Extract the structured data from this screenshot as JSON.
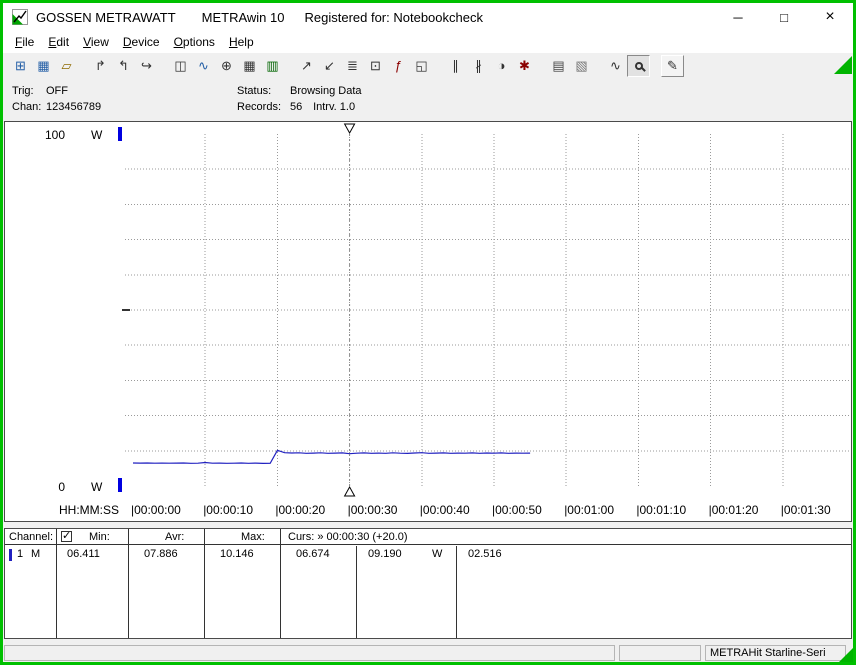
{
  "window": {
    "title_brand": "GOSSEN METRAWATT",
    "title_app": "METRAwin 10",
    "title_registered": "Registered for: Notebookcheck",
    "controls": {
      "minimize": "─",
      "maximize": "□",
      "close": "×"
    }
  },
  "menu": {
    "items": [
      "File",
      "Edit",
      "View",
      "Device",
      "Options",
      "Help"
    ]
  },
  "toolbar": {
    "groups": [
      [
        {
          "name": "export-file",
          "glyph": "⊞",
          "color": "#245fa6"
        },
        {
          "name": "save-file",
          "glyph": "▦",
          "color": "#245fa6"
        },
        {
          "name": "open-file",
          "glyph": "▱",
          "color": "#8f6a00"
        }
      ],
      [
        {
          "name": "export-data",
          "glyph": "↱",
          "color": "#333333"
        },
        {
          "name": "import-data",
          "glyph": "↰",
          "color": "#333333"
        },
        {
          "name": "transfer-data",
          "glyph": "↪",
          "color": "#333333"
        }
      ],
      [
        {
          "name": "multimeter-view",
          "glyph": "◫",
          "color": "#333333"
        },
        {
          "name": "trend-view",
          "glyph": "∿",
          "color": "#245fa6"
        },
        {
          "name": "scope-view",
          "glyph": "⊕",
          "color": "#333333"
        },
        {
          "name": "table-view",
          "glyph": "▦",
          "color": "#333333"
        },
        {
          "name": "bargraph-view",
          "glyph": "▥",
          "color": "#006400"
        }
      ],
      [
        {
          "name": "graph-export",
          "glyph": "↗",
          "color": "#333333"
        },
        {
          "name": "graph-import",
          "glyph": "↙",
          "color": "#333333"
        },
        {
          "name": "data-logger",
          "glyph": "≣",
          "color": "#333333"
        },
        {
          "name": "device-monitor",
          "glyph": "⊡",
          "color": "#333333"
        },
        {
          "name": "function-display",
          "glyph": "ƒ",
          "color": "#8b0000"
        },
        {
          "name": "live-display",
          "glyph": "◱",
          "color": "#333333"
        }
      ],
      [
        {
          "name": "cursor-left",
          "glyph": "∥",
          "color": "#333333"
        },
        {
          "name": "cursor-right",
          "glyph": "∦",
          "color": "#333333"
        },
        {
          "name": "time-range",
          "glyph": "◑",
          "color": "#333333"
        },
        {
          "name": "event-marker",
          "glyph": "✱",
          "color": "#8b0000"
        }
      ],
      [
        {
          "name": "print",
          "glyph": "▤",
          "color": "#444444"
        },
        {
          "name": "print-preview",
          "glyph": "▧",
          "color": "#777777"
        }
      ],
      [
        {
          "name": "zoom-signal",
          "glyph": "∿",
          "color": "#333333"
        },
        {
          "name": "zoom",
          "glyph": "@magnifier",
          "color": "#333333",
          "state": "pressed"
        }
      ],
      [
        {
          "name": "annotation",
          "glyph": "✎",
          "color": "#333333",
          "state": "raised"
        }
      ]
    ]
  },
  "infobar": {
    "trig_label": "Trig:",
    "trig_value": "OFF",
    "chan_label": "Chan:",
    "chan_value": "123456789",
    "status_label": "Status:",
    "status_value": "Browsing Data",
    "records_label": "Records:",
    "records_value": "56",
    "interval_label": "Intrv.",
    "interval_value": "1.0"
  },
  "chart_data": {
    "type": "line",
    "title": "",
    "ylabel": "W",
    "y_top_label": "100",
    "y_bottom_label": "0",
    "ylim": [
      0,
      100
    ],
    "y_grid_interval": 10,
    "grid": true,
    "x_axis_label": "HH:MM:SS",
    "x_tick_seconds": [
      0,
      10,
      20,
      30,
      40,
      50,
      60,
      70,
      80,
      90
    ],
    "x_tick_labels": [
      "00:00:00",
      "00:00:10",
      "00:00:20",
      "00:00:30",
      "00:00:40",
      "00:00:50",
      "00:01:00",
      "00:01:10",
      "00:01:20",
      "00:01:30"
    ],
    "x_visible_span_s": 101,
    "axis_marker_color": "#0000e0",
    "cursor": {
      "time_s": 30,
      "time_label": "00:00:30",
      "offset_label": "+20.0"
    },
    "series": [
      {
        "name": "Channel 1",
        "unit": "W",
        "color": "#2020c0",
        "start_s": 0,
        "interval_s": 1.0,
        "values": [
          6.53,
          6.5,
          6.52,
          6.48,
          6.51,
          6.47,
          6.5,
          6.53,
          6.46,
          6.49,
          6.67,
          6.47,
          6.5,
          6.45,
          6.48,
          6.52,
          6.46,
          6.5,
          6.41,
          6.45,
          10.15,
          9.45,
          9.38,
          9.42,
          9.3,
          9.35,
          9.42,
          9.28,
          9.36,
          9.4,
          9.19,
          9.33,
          9.4,
          9.28,
          9.35,
          9.3,
          9.42,
          9.33,
          9.27,
          9.38,
          9.45,
          9.3,
          9.36,
          9.41,
          9.28,
          9.35,
          9.32,
          9.4,
          9.3,
          9.37,
          9.33,
          9.4,
          9.28,
          9.35,
          9.31,
          9.36
        ]
      }
    ]
  },
  "table": {
    "header": {
      "channel": "Channel:",
      "channel_checked": true,
      "min": "Min:",
      "avr": "Avr:",
      "max": "Max:",
      "curs": "Curs: » 00:00:30 (+20.0)"
    },
    "row": {
      "channel": "1",
      "mode": "M",
      "min": "06.411",
      "avr": "07.886",
      "max": "10.146",
      "curs_a": "06.674",
      "curs_b": "09.190",
      "curs_b_unit": "W",
      "delta": "02.516"
    }
  },
  "statusbar": {
    "device": "METRAHit Starline-Seri"
  },
  "colors": {
    "window_border": "#00c000",
    "accent_green": "#00b400",
    "trace_blue": "#2020c0"
  }
}
